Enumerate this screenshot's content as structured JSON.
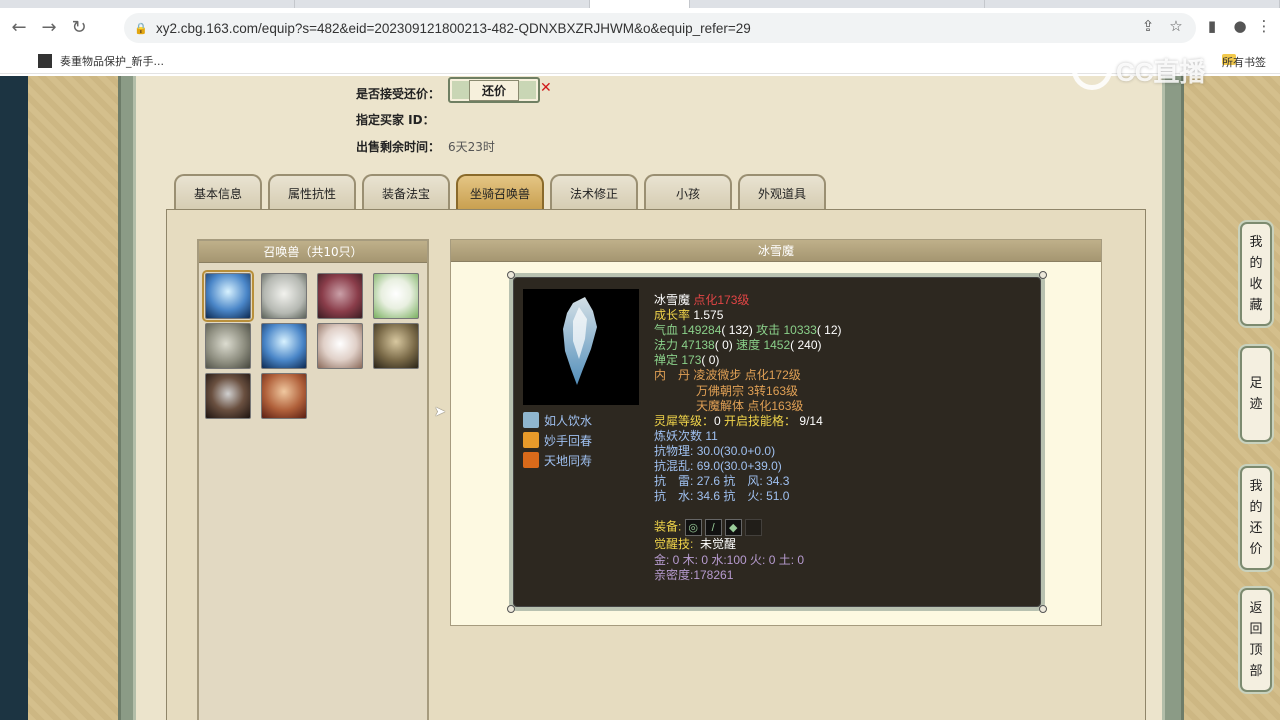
{
  "browser": {
    "url": "xy2.cbg.163.com/equip?s=482&eid=202309121800213-482-QDNXBXZRJHWM&o&equip_refer=29",
    "bookmark_1": "奏重物品保护_新手...",
    "bookmark_2": "所有书签"
  },
  "watermark": "CC直播",
  "form": {
    "accept_counter_label": "是否接受还价：",
    "counter_button": "还价",
    "buyer_id_label": "指定买家 ID：",
    "time_left_label": "出售剩余时间：",
    "time_left_value": "6天23时"
  },
  "tabs": [
    "基本信息",
    "属性抗性",
    "装备法宝",
    "坐骑召唤兽",
    "法术修正",
    "小孩",
    "外观道具"
  ],
  "active_tab": "坐骑召唤兽",
  "pet_list": {
    "title": "召唤兽（共10只）",
    "icons": [
      "ice-spirit-icon",
      "white-bear-icon",
      "red-beast-icon",
      "white-rabbit-icon",
      "gray-spirit-icon",
      "ice-spirit-icon",
      "white-beads-icon",
      "armored-warrior-icon",
      "wolf-icon",
      "female-immortal-icon"
    ],
    "selected": 0
  },
  "detail": {
    "title": "冰雪魔",
    "skills": [
      {
        "icon": "drink-icon",
        "label": "如人饮水"
      },
      {
        "icon": "fire-icon",
        "label": "妙手回春"
      },
      {
        "icon": "fire-icon",
        "label": "天地同寿"
      }
    ],
    "stats": {
      "name": "冰雪魔",
      "level": "点化173级",
      "growth_label": "成长率",
      "growth": "1.575",
      "hp_label": "气血",
      "hp": "149284",
      "hp_pts": "( 132)",
      "atk_label": "攻击",
      "atk": "10333",
      "atk_pts": "( 12)",
      "mp_label": "法力",
      "mp": "47138",
      "mp_pts": "( 0)",
      "spd_label": "速度",
      "spd": "1452",
      "spd_pts": "( 240)",
      "def_label": "禅定",
      "def": "173",
      "def_pts": "( 0)",
      "core_label": "内　丹",
      "cores": [
        {
          "name": "凌波微步",
          "level": "点化172级"
        },
        {
          "name": "万佛朝宗",
          "level": "3转163级"
        },
        {
          "name": "天魔解体",
          "level": "点化163级"
        }
      ],
      "spirit_label": "灵犀等级：",
      "spirit_level": "0",
      "slots_label": "开启技能格：",
      "slots": "9/14",
      "refine_label": "炼妖次数",
      "refine": "11",
      "res_phys_label": "抗物理:",
      "res_phys": "30.0(30.0+0.0)",
      "res_chaos_label": "抗混乱:",
      "res_chaos": "69.0(30.0+39.0)",
      "res_thunder_label": "抗　雷:",
      "res_thunder": "27.6",
      "res_wind_label": "抗　风:",
      "res_wind": "34.3",
      "res_water_label": "抗　水:",
      "res_water": "34.6",
      "res_fire_label": "抗　火:",
      "res_fire": "51.0",
      "equip_label": "装备:",
      "awaken_label": "觉醒技:",
      "awaken_value": "未觉醒",
      "elements": "金: 0 木: 0 水:100 火: 0 土: 0",
      "intimacy": "亲密度:178261"
    }
  },
  "side_nav": [
    "我的收藏",
    "足迹",
    "我的还价",
    "返回顶部"
  ],
  "colors": {
    "page_bg": "#ece4cc",
    "card_bg": "#2d2820",
    "accent_red": "#e04545",
    "stat_green": "#8ad08a",
    "label_yellow": "#f0d44a"
  }
}
